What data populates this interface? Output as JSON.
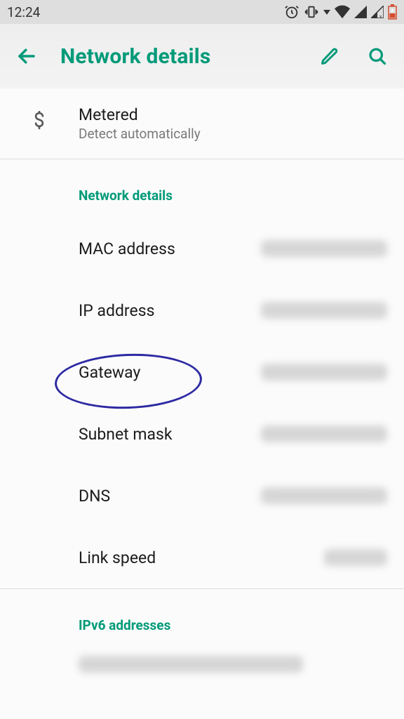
{
  "status": {
    "time": "12:24"
  },
  "appbar": {
    "title": "Network details"
  },
  "metered": {
    "title": "Metered",
    "subtitle": "Detect automatically"
  },
  "section_network_details": "Network details",
  "items": [
    {
      "label": "MAC address",
      "value": "redacted"
    },
    {
      "label": "IP address",
      "value": "redacted"
    },
    {
      "label": "Gateway",
      "value": "redacted"
    },
    {
      "label": "Subnet mask",
      "value": "redacted"
    },
    {
      "label": "DNS",
      "value": "redacted"
    },
    {
      "label": "Link speed",
      "value": "redacted"
    }
  ],
  "section_ipv6": "IPv6 addresses",
  "ipv6_value": "redacted",
  "colors": {
    "accent": "#009a79",
    "annotation": "#2d2aa3"
  }
}
